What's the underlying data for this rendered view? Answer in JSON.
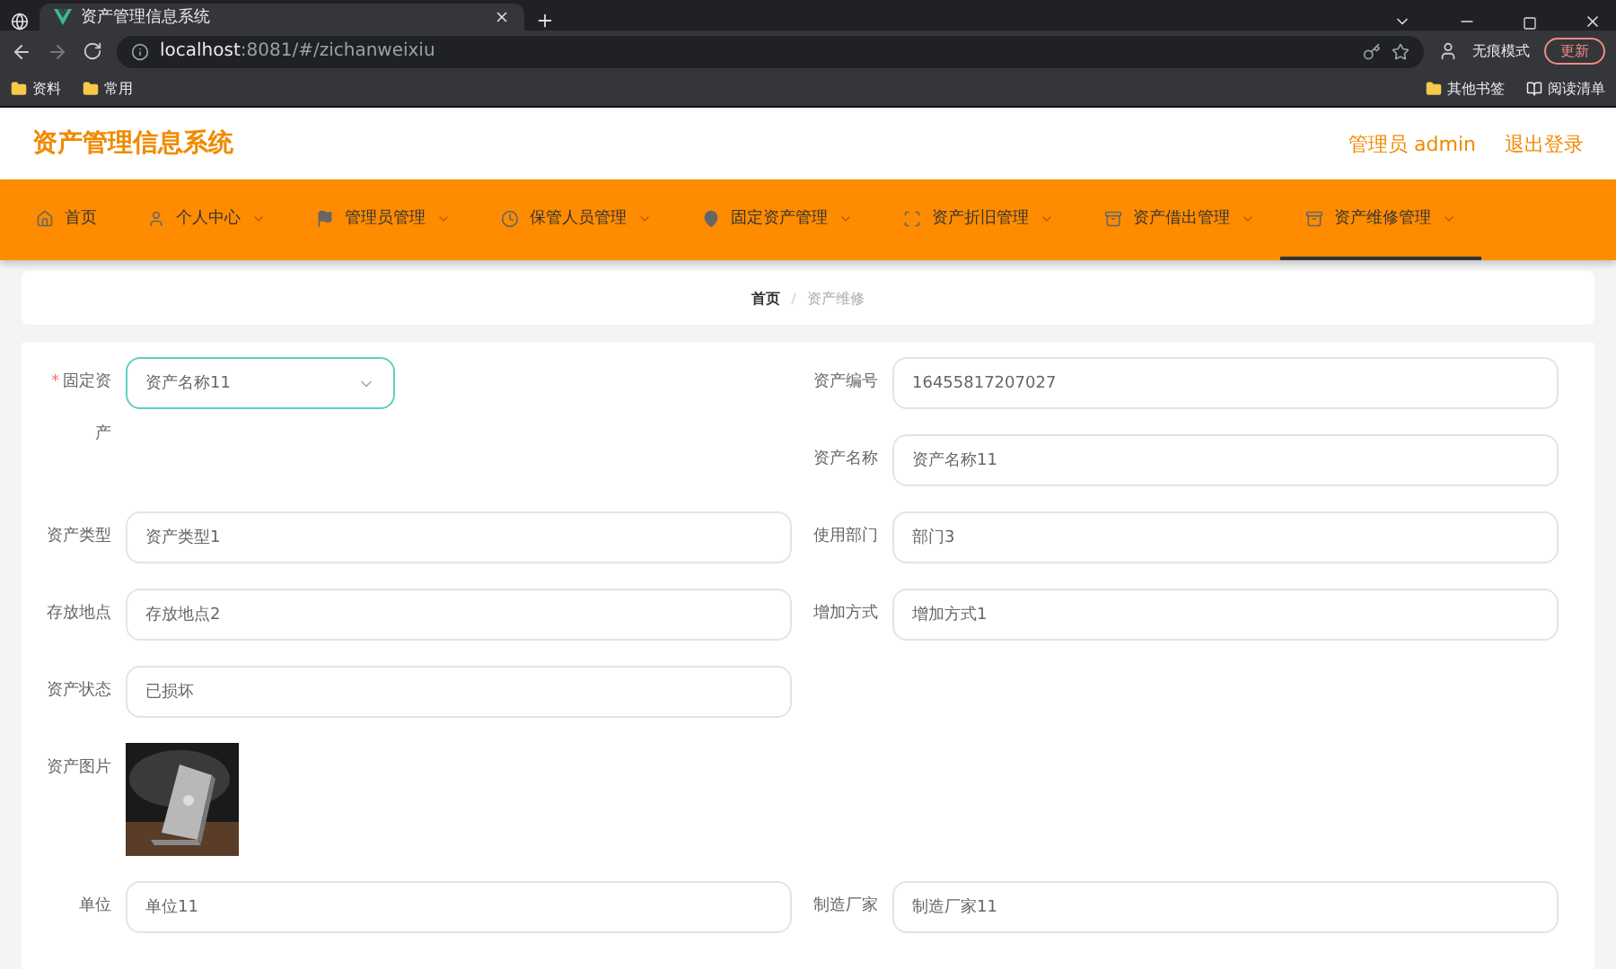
{
  "browser": {
    "tab_title": "资产管理信息系统",
    "url_host": "localhost",
    "url_rest": ":8081/#/zichanweixiu",
    "incognito": "无痕模式",
    "update": "更新",
    "bookmarks": [
      "资料",
      "常用"
    ],
    "other_bookmarks": "其他书签",
    "reading_list": "阅读清单"
  },
  "header": {
    "title": "资产管理信息系统",
    "user": "管理员 admin",
    "logout": "退出登录"
  },
  "nav": [
    {
      "label": "首页",
      "dropdown": false,
      "selected": false
    },
    {
      "label": "个人中心",
      "dropdown": true,
      "selected": false
    },
    {
      "label": "管理员管理",
      "dropdown": true,
      "selected": false
    },
    {
      "label": "保管人员管理",
      "dropdown": true,
      "selected": false
    },
    {
      "label": "固定资产管理",
      "dropdown": true,
      "selected": false
    },
    {
      "label": "资产折旧管理",
      "dropdown": true,
      "selected": false
    },
    {
      "label": "资产借出管理",
      "dropdown": true,
      "selected": false
    },
    {
      "label": "资产维修管理",
      "dropdown": true,
      "selected": true
    }
  ],
  "breadcrumb": {
    "separator": "/",
    "items": [
      {
        "label": "首页",
        "current": false
      },
      {
        "label": "资产维修",
        "current": true
      }
    ]
  },
  "required_mark": "*",
  "fields": [
    {
      "kind": "select",
      "label": "固定资产",
      "value": "资产名称11",
      "required": true
    },
    {
      "kind": "text",
      "label": "资产编号",
      "value": "16455817207027"
    },
    {
      "kind": "text",
      "label": "资产名称",
      "value": "资产名称11"
    },
    {
      "kind": "text",
      "label": "资产类型",
      "value": "资产类型1"
    },
    {
      "kind": "text",
      "label": "使用部门",
      "value": "部门3"
    },
    {
      "kind": "text",
      "label": "存放地点",
      "value": "存放地点2"
    },
    {
      "kind": "text",
      "label": "增加方式",
      "value": "增加方式1"
    },
    {
      "kind": "text",
      "label": "资产状态",
      "value": "已损坏"
    },
    {
      "label": "资产图片"
    },
    {
      "kind": "text",
      "label": "单位",
      "value": "单位11"
    },
    {
      "kind": "text",
      "label": "制造厂家",
      "value": "制造厂家11"
    }
  ]
}
